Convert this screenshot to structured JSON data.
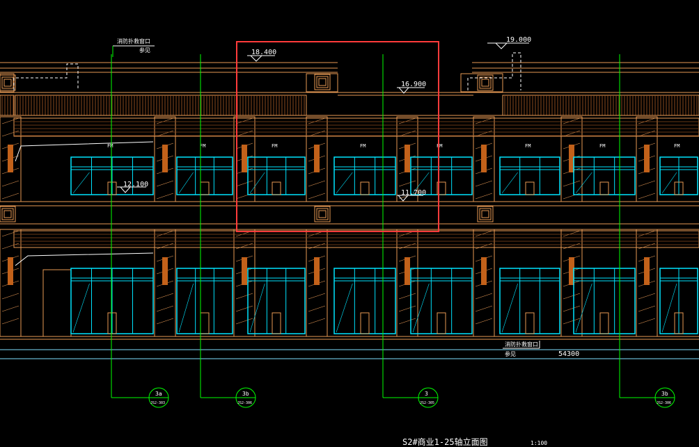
{
  "drawing": {
    "title": "S2#商业1-25轴立面图",
    "scale": "1:100",
    "overall_dimension": "54300",
    "elevations": {
      "top_left": "18.400",
      "top_right": "19.000",
      "roof_parapet": "16.900",
      "second_floor_left": "12.100",
      "second_floor_mid": "11.700"
    },
    "notes": {
      "top_note_line1": "消防扑救窗口",
      "top_note_line2": "参见",
      "bottom_note_line1": "消防扑救窗口",
      "bottom_note_line2": "参见"
    },
    "axis_tags": [
      {
        "label": "3a",
        "ref": "JS2-303"
      },
      {
        "label": "3b",
        "ref": "JS2-306"
      },
      {
        "label": "3",
        "ref": "JS2-305"
      },
      {
        "label": "3b",
        "ref": "JS2-306"
      }
    ],
    "window_tag": "FM",
    "colors": {
      "background": "#000000",
      "wall": "#e89a55",
      "brick": "#8a4a1e",
      "glass": "#00e5ff",
      "axis": "#00ff00",
      "selection": "#ff3b3b",
      "label": "#ffffff",
      "column": "#c2611a"
    }
  }
}
